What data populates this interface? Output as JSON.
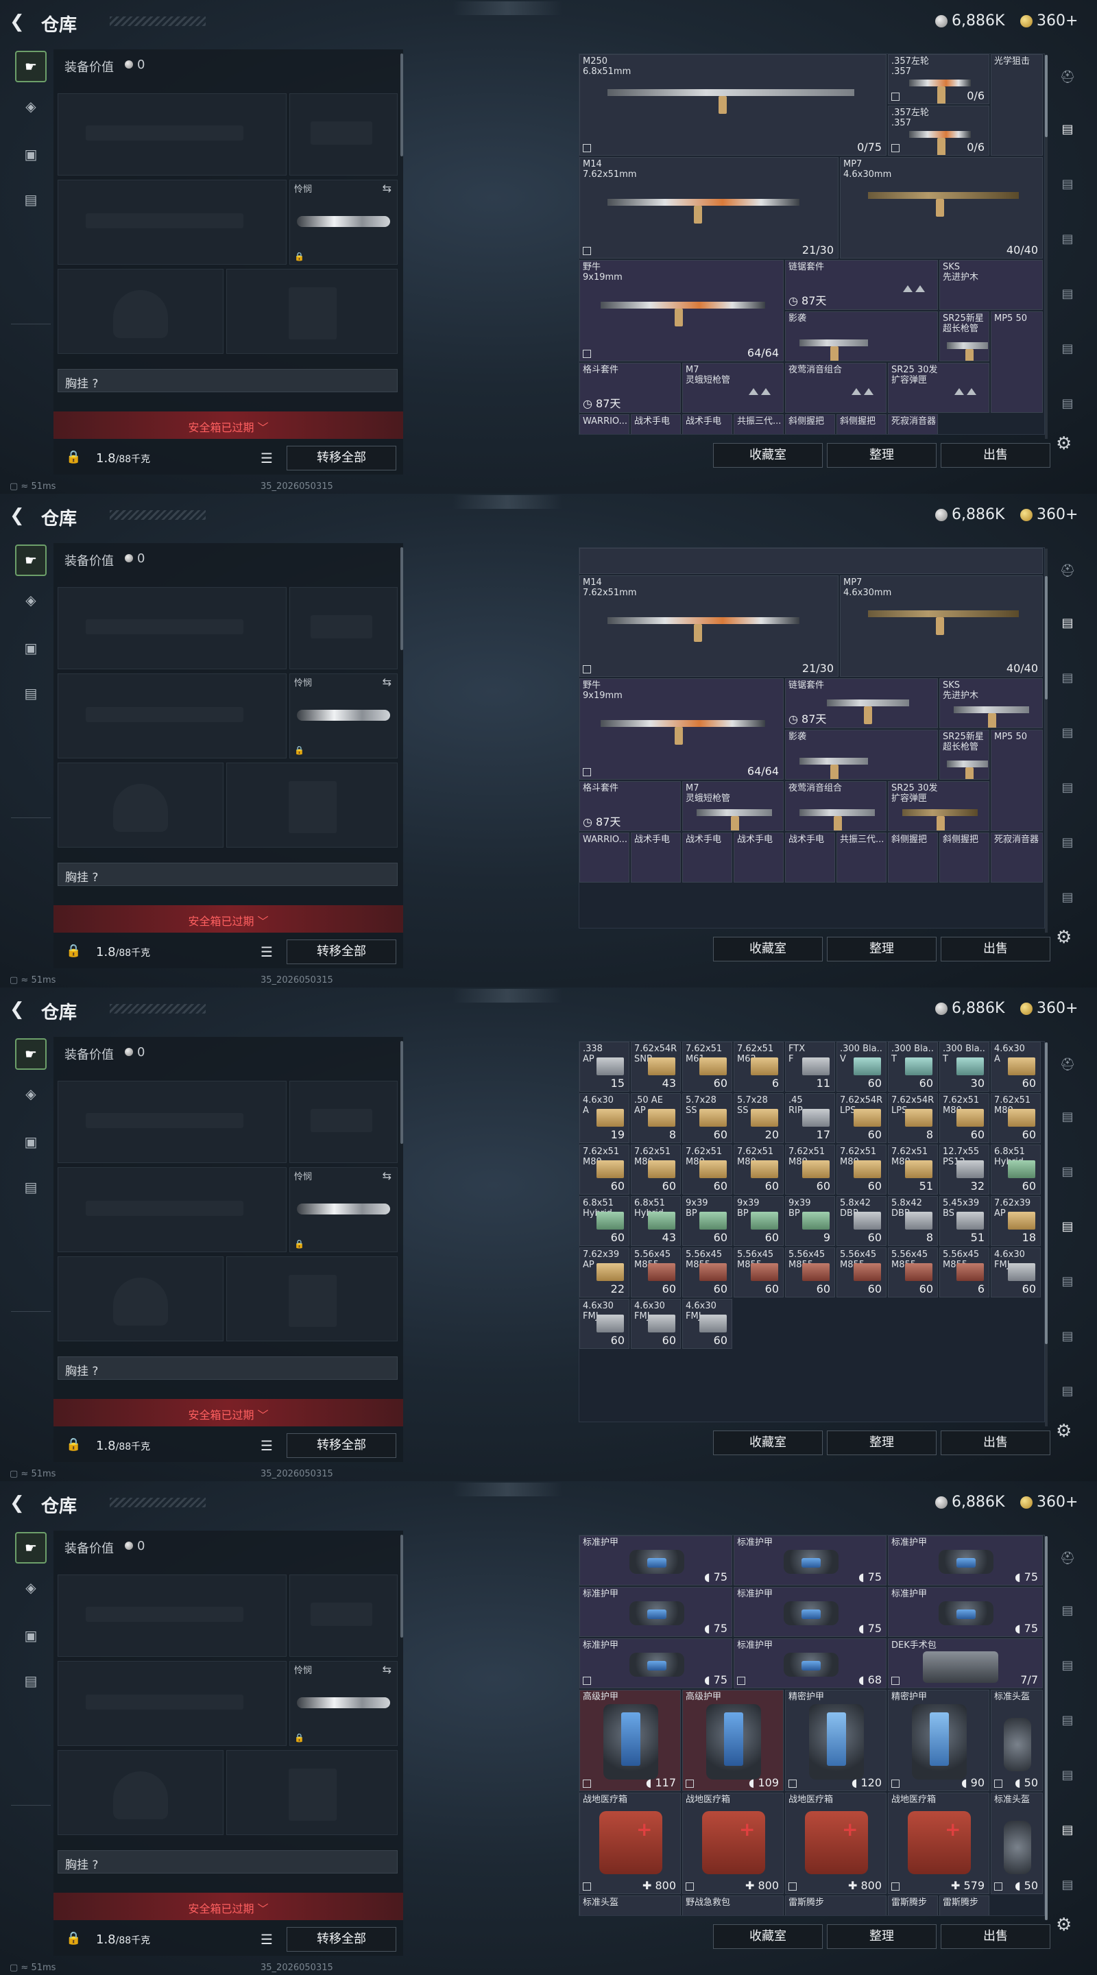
{
  "header": {
    "title": "仓库",
    "silver_amount": "6,886K",
    "gold_amount": "360+"
  },
  "loadout": {
    "value_label": "装备价值",
    "value_amount": "0",
    "melee_label": "怜悯",
    "chest_label": "胸挂 ?",
    "safe_box_text": "安全箱已过期 ﹀",
    "weight_value": "1.8",
    "weight_max": "/88千克",
    "transfer_all": "转移全部"
  },
  "status": {
    "ping": "51ms",
    "build": "35_2026050315"
  },
  "actions": {
    "collection": "收藏室",
    "organize": "整理",
    "sell": "出售"
  },
  "screens": [
    {
      "weapons": [
        {
          "name": "M250\n6.8x51mm",
          "count": "0/75"
        },
        {
          "name": ".357左轮\n.357",
          "count": "0/6"
        },
        {
          "name": "光学狙击",
          "count": ""
        },
        {
          "name": ".357左轮\n.357",
          "count": "0/6"
        },
        {
          "name": "M14\n7.62x51mm",
          "count": "21/30"
        },
        {
          "name": "MP7\n4.6x30mm",
          "count": "40/40"
        },
        {
          "name": "野牛\n9x19mm",
          "count": "64/64"
        },
        {
          "name": "链锯套件",
          "count": "87天"
        },
        {
          "name": "SKS\n先进护木",
          "count": ""
        },
        {
          "name": "影袭",
          "count": ""
        },
        {
          "name": "SR25新星\n超长枪管",
          "count": ""
        },
        {
          "name": "MP5 50",
          "count": ""
        },
        {
          "name": "格斗套件",
          "count": "87天"
        },
        {
          "name": "M7\n灵蛾短枪管",
          "count": ""
        },
        {
          "name": "夜莺消音组合",
          "count": ""
        },
        {
          "name": "SR25 30发\n扩容弹匣",
          "count": ""
        },
        {
          "name": "WARRIO...",
          "count": ""
        },
        {
          "name": "战术手电",
          "count": ""
        },
        {
          "name": "战术手电",
          "count": ""
        },
        {
          "name": "共振三代...",
          "count": ""
        },
        {
          "name": "斜侧握把",
          "count": ""
        },
        {
          "name": "斜侧握把",
          "count": ""
        },
        {
          "name": "死寂消音器",
          "count": ""
        }
      ]
    },
    {
      "weapons": [
        {
          "name": "M14\n7.62x51mm",
          "count": "21/30"
        },
        {
          "name": "MP7\n4.6x30mm",
          "count": "40/40"
        },
        {
          "name": "野牛\n9x19mm",
          "count": "64/64"
        },
        {
          "name": "链锯套件",
          "count": "87天"
        },
        {
          "name": "SKS\n先进护木",
          "count": ""
        },
        {
          "name": "影袭",
          "count": ""
        },
        {
          "name": "SR25新星\n超长枪管",
          "count": ""
        },
        {
          "name": "MP5 50",
          "count": ""
        },
        {
          "name": "格斗套件",
          "count": "87天"
        },
        {
          "name": "M7\n灵蛾短枪管",
          "count": ""
        },
        {
          "name": "夜莺消音组合",
          "count": ""
        },
        {
          "name": "SR25 30发\n扩容弹匣",
          "count": ""
        },
        {
          "name": "WARRIO...",
          "count": ""
        },
        {
          "name": "战术手电",
          "count": ""
        },
        {
          "name": "战术手电",
          "count": ""
        },
        {
          "name": "战术手电",
          "count": ""
        },
        {
          "name": "战术手电",
          "count": ""
        },
        {
          "name": "共振三代...",
          "count": ""
        },
        {
          "name": "斜侧握把",
          "count": ""
        },
        {
          "name": "斜侧握把",
          "count": ""
        },
        {
          "name": "死寂消音器",
          "count": ""
        }
      ]
    },
    {
      "ammo": [
        {
          "name": ".338\nAP",
          "count": "15",
          "color": "grey"
        },
        {
          "name": "7.62x54R\nSNB",
          "count": "43",
          "color": "gold"
        },
        {
          "name": "7.62x51\nM61",
          "count": "60",
          "color": "gold"
        },
        {
          "name": "7.62x51\nM62",
          "count": "6",
          "color": "gold"
        },
        {
          "name": "FTX\nF",
          "count": "11",
          "color": "grey"
        },
        {
          "name": ".300 Bla..\nV",
          "count": "60",
          "color": "teal"
        },
        {
          "name": ".300 Bla..\nT",
          "count": "60",
          "color": "teal"
        },
        {
          "name": ".300 Bla..\nT",
          "count": "30",
          "color": "teal"
        },
        {
          "name": "4.6x30\nA",
          "count": "60",
          "color": "gold"
        },
        {
          "name": "4.6x30\nA",
          "count": "19",
          "color": "gold"
        },
        {
          "name": ".50 AE\nAP",
          "count": "8",
          "color": "gold"
        },
        {
          "name": "5.7x28\nSS",
          "count": "60",
          "color": "gold"
        },
        {
          "name": "5.7x28\nSS",
          "count": "20",
          "color": "gold"
        },
        {
          "name": ".45\nRIP",
          "count": "17",
          "color": "grey"
        },
        {
          "name": "7.62x54R\nLPS",
          "count": "60",
          "color": "gold"
        },
        {
          "name": "7.62x54R\nLPS",
          "count": "8",
          "color": "gold"
        },
        {
          "name": "7.62x51\nM80",
          "count": "60",
          "color": "gold"
        },
        {
          "name": "7.62x51\nM80",
          "count": "60",
          "color": "gold"
        },
        {
          "name": "7.62x51\nM80",
          "count": "60",
          "color": "gold"
        },
        {
          "name": "7.62x51\nM80",
          "count": "60",
          "color": "gold"
        },
        {
          "name": "7.62x51\nM80",
          "count": "60",
          "color": "gold"
        },
        {
          "name": "7.62x51\nM80",
          "count": "60",
          "color": "gold"
        },
        {
          "name": "7.62x51\nM80",
          "count": "60",
          "color": "gold"
        },
        {
          "name": "7.62x51\nM80",
          "count": "60",
          "color": "gold"
        },
        {
          "name": "7.62x51\nM80",
          "count": "51",
          "color": "gold"
        },
        {
          "name": "12.7x55\nPS12",
          "count": "32",
          "color": "grey"
        },
        {
          "name": "6.8x51\nHybrid",
          "count": "60",
          "color": "green"
        },
        {
          "name": "6.8x51\nHybrid",
          "count": "60",
          "color": "green"
        },
        {
          "name": "6.8x51\nHybrid",
          "count": "43",
          "color": "green"
        },
        {
          "name": "9x39\nBP",
          "count": "60",
          "color": "green"
        },
        {
          "name": "9x39\nBP",
          "count": "60",
          "color": "green"
        },
        {
          "name": "9x39\nBP",
          "count": "9",
          "color": "green"
        },
        {
          "name": "5.8x42\nDBP",
          "count": "60",
          "color": "grey"
        },
        {
          "name": "5.8x42\nDBP",
          "count": "8",
          "color": "grey"
        },
        {
          "name": "5.45x39\nBS",
          "count": "51",
          "color": "grey"
        },
        {
          "name": "7.62x39\nAP",
          "count": "18",
          "color": "gold"
        },
        {
          "name": "7.62x39\nAP",
          "count": "22",
          "color": "gold"
        },
        {
          "name": "5.56x45\nM855",
          "count": "60",
          "color": "red"
        },
        {
          "name": "5.56x45\nM855",
          "count": "60",
          "color": "red"
        },
        {
          "name": "5.56x45\nM855",
          "count": "60",
          "color": "red"
        },
        {
          "name": "5.56x45\nM855",
          "count": "60",
          "color": "red"
        },
        {
          "name": "5.56x45\nM855",
          "count": "60",
          "color": "red"
        },
        {
          "name": "5.56x45\nM855",
          "count": "60",
          "color": "red"
        },
        {
          "name": "5.56x45\nM855",
          "count": "6",
          "color": "red"
        },
        {
          "name": "4.6x30\nFMJ",
          "count": "60",
          "color": "grey"
        },
        {
          "name": "4.6x30\nFMJ",
          "count": "60",
          "color": "grey"
        },
        {
          "name": "4.6x30\nFMJ",
          "count": "60",
          "color": "grey"
        },
        {
          "name": "4.6x30\nFMJ",
          "count": "60",
          "color": "grey"
        }
      ]
    },
    {
      "gear": [
        {
          "name": "标准护甲",
          "count": "75"
        },
        {
          "name": "标准护甲",
          "count": "75"
        },
        {
          "name": "标准护甲",
          "count": "75"
        },
        {
          "name": "标准护甲",
          "count": "75"
        },
        {
          "name": "标准护甲",
          "count": "75"
        },
        {
          "name": "标准护甲",
          "count": "75"
        },
        {
          "name": "标准护甲",
          "count": "75"
        },
        {
          "name": "标准护甲",
          "count": "68"
        },
        {
          "name": "DEK手术包",
          "count": "7/7"
        },
        {
          "name": "高级护甲",
          "count": "117"
        },
        {
          "name": "高级护甲",
          "count": "109"
        },
        {
          "name": "精密护甲",
          "count": "120"
        },
        {
          "name": "精密护甲",
          "count": "90"
        },
        {
          "name": "标准头盔",
          "count": "50"
        },
        {
          "name": "战地医疗箱",
          "count": "800"
        },
        {
          "name": "战地医疗箱",
          "count": "800"
        },
        {
          "name": "战地医疗箱",
          "count": "800"
        },
        {
          "name": "战地医疗箱",
          "count": "579"
        },
        {
          "name": "标准头盔",
          "count": "50"
        },
        {
          "name": "标准头盔",
          "count": ""
        },
        {
          "name": "野战急救包",
          "count": ""
        },
        {
          "name": "雷斯腾步",
          "count": ""
        },
        {
          "name": "雷斯腾步",
          "count": ""
        },
        {
          "name": "雷斯腾步",
          "count": ""
        }
      ]
    }
  ]
}
